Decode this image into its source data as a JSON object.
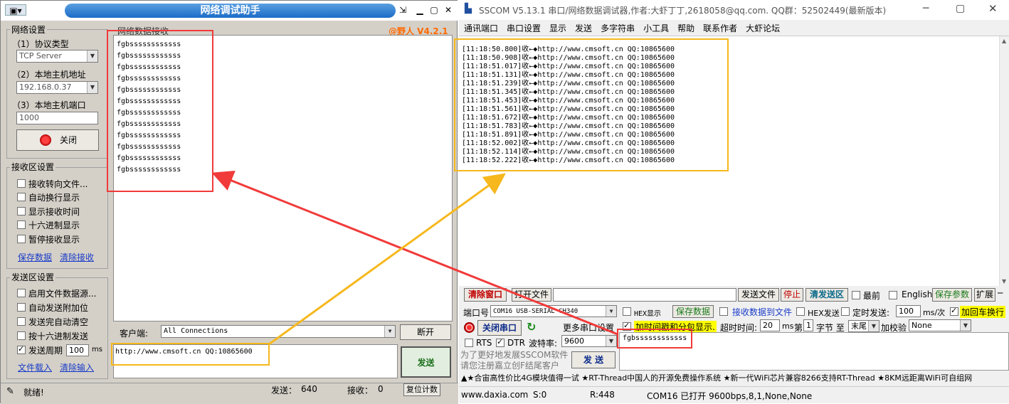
{
  "left_window": {
    "title": "网络调试助手",
    "version_badge": "@野人 V4.2.1",
    "network_settings": {
      "group_label": "网络设置",
      "protocol_label": "（1）协议类型",
      "protocol_value": "TCP Server",
      "host_label": "（2）本地主机地址",
      "host_value": "192.168.0.37",
      "port_label": "（3）本地主机端口",
      "port_value": "1000",
      "close_button": "关闭"
    },
    "receive_settings": {
      "group_label": "接收区设置",
      "options": [
        "接收转向文件...",
        "自动换行显示",
        "显示接收时间",
        "十六进制显示",
        "暂停接收显示"
      ],
      "save_link": "保存数据",
      "clear_link": "清除接收"
    },
    "send_settings": {
      "group_label": "发送区设置",
      "options": [
        "启用文件数据源...",
        "自动发送附加位",
        "发送完自动清空",
        "按十六进制发送",
        "发送周期"
      ],
      "period_value": "100",
      "period_unit": "ms",
      "file_link": "文件载入",
      "clear_link": "清除输入"
    },
    "receive_area": {
      "label": "网络数据接收",
      "lines": [
        "fgbssssssssssss",
        "fgbssssssssssss",
        "fgbssssssssssss",
        "fgbssssssssssss",
        "fgbssssssssssss",
        "fgbssssssssssss",
        "fgbssssssssssss",
        "fgbssssssssssss",
        "fgbssssssssssss",
        "fgbssssssssssss",
        "fgbssssssssssss",
        "fgbssssssssssss"
      ]
    },
    "client": {
      "label": "客户端:",
      "value": "All Connections",
      "disconnect_button": "断开"
    },
    "send_input": "http://www.cmsoft.cn QQ:10865600",
    "send_button": "发送",
    "status": {
      "ready": "就绪!",
      "sent_label": "发送：",
      "sent_value": "640",
      "recv_label": "接收：",
      "recv_value": "0",
      "reset_button": "复位计数"
    }
  },
  "right_window": {
    "title": "SSCOM V5.13.1 串口/网络数据调试器,作者:大虾丁丁,2618058@qq.com. QQ群：52502449(最新版本)",
    "menu": [
      "通讯端口",
      "串口设置",
      "显示",
      "发送",
      "多字符串",
      "小工具",
      "帮助",
      "联系作者",
      "大虾论坛"
    ],
    "log": [
      {
        "time": "[11:18:50.800]",
        "dir": "收←◆",
        "text": "http://www.cmsoft.cn QQ:10865600"
      },
      {
        "time": "[11:18:50.908]",
        "dir": "收←◆",
        "text": "http://www.cmsoft.cn QQ:10865600"
      },
      {
        "time": "[11:18:51.017]",
        "dir": "收←◆",
        "text": "http://www.cmsoft.cn QQ:10865600"
      },
      {
        "time": "[11:18:51.131]",
        "dir": "收←◆",
        "text": "http://www.cmsoft.cn QQ:10865600"
      },
      {
        "time": "[11:18:51.239]",
        "dir": "收←◆",
        "text": "http://www.cmsoft.cn QQ:10865600"
      },
      {
        "time": "[11:18:51.345]",
        "dir": "收←◆",
        "text": "http://www.cmsoft.cn QQ:10865600"
      },
      {
        "time": "[11:18:51.453]",
        "dir": "收←◆",
        "text": "http://www.cmsoft.cn QQ:10865600"
      },
      {
        "time": "[11:18:51.561]",
        "dir": "收←◆",
        "text": "http://www.cmsoft.cn QQ:10865600"
      },
      {
        "time": "[11:18:51.672]",
        "dir": "收←◆",
        "text": "http://www.cmsoft.cn QQ:10865600"
      },
      {
        "time": "[11:18:51.783]",
        "dir": "收←◆",
        "text": "http://www.cmsoft.cn QQ:10865600"
      },
      {
        "time": "[11:18:51.891]",
        "dir": "收←◆",
        "text": "http://www.cmsoft.cn QQ:10865600"
      },
      {
        "time": "[11:18:52.002]",
        "dir": "收←◆",
        "text": "http://www.cmsoft.cn QQ:10865600"
      },
      {
        "time": "[11:18:52.114]",
        "dir": "收←◆",
        "text": "http://www.cmsoft.cn QQ:10865600"
      },
      {
        "time": "[11:18:52.222]",
        "dir": "收←◆",
        "text": "http://www.cmsoft.cn QQ:10865600"
      }
    ],
    "toolbar": {
      "clear_window": "清除窗口",
      "open_file": "打开文件",
      "send_file": "发送文件",
      "stop": "停止",
      "clear_send": "清发送区",
      "topmost": "最前",
      "english": "English",
      "save_params": "保存参数",
      "expand": "扩展"
    },
    "controls": {
      "port_label": "端口号",
      "port_value": "COM16 USB-SERIAL CH340",
      "hex_display": "HEX显示",
      "save_data": "保存数据",
      "recv_to_file": "接收数据到文件",
      "hex_send": "HEX发送",
      "timed_send": "定时发送:",
      "interval": "100",
      "interval_unit": "ms/次",
      "add_crlf": "加回车换行",
      "close_port": "关闭串口",
      "more_settings": "更多串口设置",
      "timestamp": "加时间戳和分包显示.",
      "timeout_label": "超时时间:",
      "timeout_value": "20",
      "timeout_unit": "ms",
      "byte_prefix": "第",
      "byte_index": "1",
      "byte_label": "字节 至",
      "byte_end": "末尾",
      "checksum_label": "加校验",
      "checksum_value": "None",
      "rts": "RTS",
      "dtr": "DTR",
      "baud_label": "波特率:",
      "baud_value": "9600",
      "send_text": "fgbssssssssssss",
      "send_button": "发 送",
      "promo": "为了更好地发展SSCOM软件\n请您注册嘉立创F结尾客户"
    },
    "ticker": "▲★合宙高性价比4G模块值得一试 ★RT-Thread中国人的开源免费操作系统 ★新一代WiFi芯片兼容8266支持RT-Thread ★8KM远距离WiFi可自组网",
    "status": {
      "site": "www.daxia.com",
      "s": "S:0",
      "r": "R:448",
      "port_state": "COM16 已打开  9600bps,8,1,None,None"
    }
  }
}
